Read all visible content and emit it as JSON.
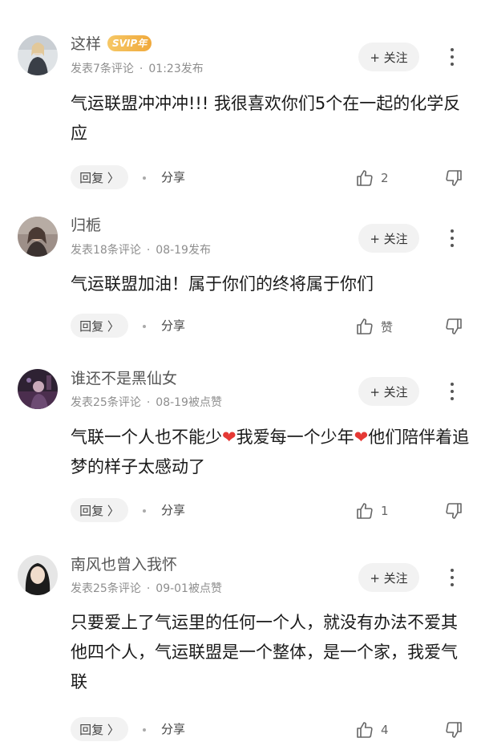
{
  "comments": [
    {
      "username": "这样",
      "badge": "SVIP年",
      "post_count": "发表7条评论",
      "time": "01:23发布",
      "follow_label": "+ 关注",
      "text": "气运联盟冲冲冲!!! 我很喜欢你们5个在一起的化学反应",
      "reply_label": "回复 〉",
      "share_label": "分享",
      "like_count": "2"
    },
    {
      "username": "归栀",
      "post_count": "发表18条评论",
      "time": "08-19发布",
      "follow_label": "+ 关注",
      "text": "气运联盟加油！属于你们的终将属于你们",
      "reply_label": "回复 〉",
      "share_label": "分享",
      "like_count": "赞"
    },
    {
      "username": "谁还不是黑仙女",
      "post_count": "发表25条评论",
      "time": "08-19被点赞",
      "follow_label": "+ 关注",
      "text_a": "气联一个人也不能少",
      "text_b": "我爱每一个少年",
      "text_c": "他们陪伴着追梦的样子太感动了",
      "heart": "❤",
      "reply_label": "回复 〉",
      "share_label": "分享",
      "like_count": "1"
    },
    {
      "username": "南风也曾入我怀",
      "post_count": "发表25条评论",
      "time": "09-01被点赞",
      "follow_label": "+ 关注",
      "text": "只要爱上了气运里的任何一个人，就没有办法不爱其他四个人，气运联盟是一个整体，是一个家，我爱气联",
      "reply_label": "回复 〉",
      "share_label": "分享",
      "like_count": "4"
    }
  ],
  "icons": {
    "like": "thumbs-up-icon",
    "dislike": "thumbs-down-icon",
    "more": "more-vertical-icon"
  },
  "colors": {
    "svip_gold": "#f0a93c",
    "heart_red": "#e53935"
  }
}
